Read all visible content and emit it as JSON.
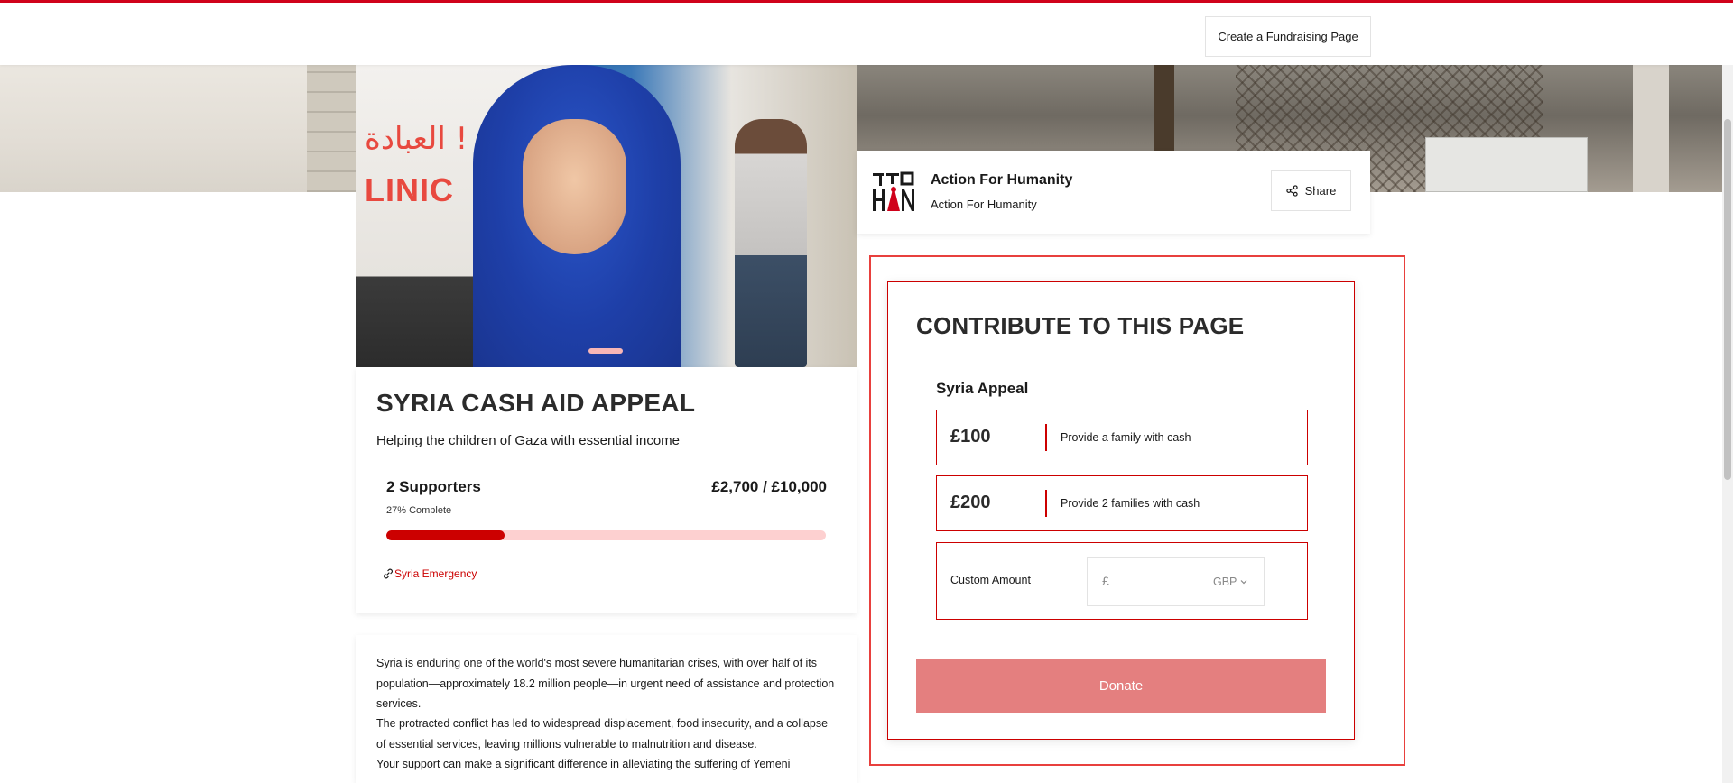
{
  "header": {
    "create_button": "Create a Fundraising Page"
  },
  "campaign": {
    "image_text_arabic": "العبادة !",
    "image_text_clinic": "LINIC",
    "title": "SYRIA CASH AID APPEAL",
    "subtitle": "Helping the children of Gaza with essential income",
    "supporters": "2 Supporters",
    "raised": "£2,700 / £10,000",
    "complete_text": "27% Complete",
    "progress_fraction": 0.27,
    "tag": "Syria Emergency",
    "description": [
      "Syria is enduring one of the world's most severe humanitarian crises, with over half of its population—approximately 18.2 million people—in urgent need of assistance and protection services.",
      "The protracted conflict has led to widespread displacement, food insecurity, and a collapse of essential services, leaving millions vulnerable to malnutrition and disease.",
      "Your support can make a significant difference in alleviating the suffering of Yemeni"
    ]
  },
  "charity": {
    "name": "Action For Humanity",
    "subname": "Action For Humanity",
    "share_label": "Share"
  },
  "contribute": {
    "title": "CONTRIBUTE TO THIS PAGE",
    "appeal_name": "Syria Appeal",
    "options": [
      {
        "price": "£100",
        "desc": "Provide a family with cash"
      },
      {
        "price": "£200",
        "desc": "Provide 2 families with cash"
      }
    ],
    "custom_label": "Custom Amount",
    "currency_symbol": "£",
    "currency": "GBP",
    "donate_label": "Donate"
  },
  "colors": {
    "brand_red": "#cc0000",
    "progress_track": "#fdd0d0",
    "donate_button": "#e47f7f",
    "outer_highlight": "#e8403d"
  },
  "icons": {
    "tag": "link-icon",
    "share": "share-icon",
    "currency_dropdown": "chevron-down-icon"
  }
}
